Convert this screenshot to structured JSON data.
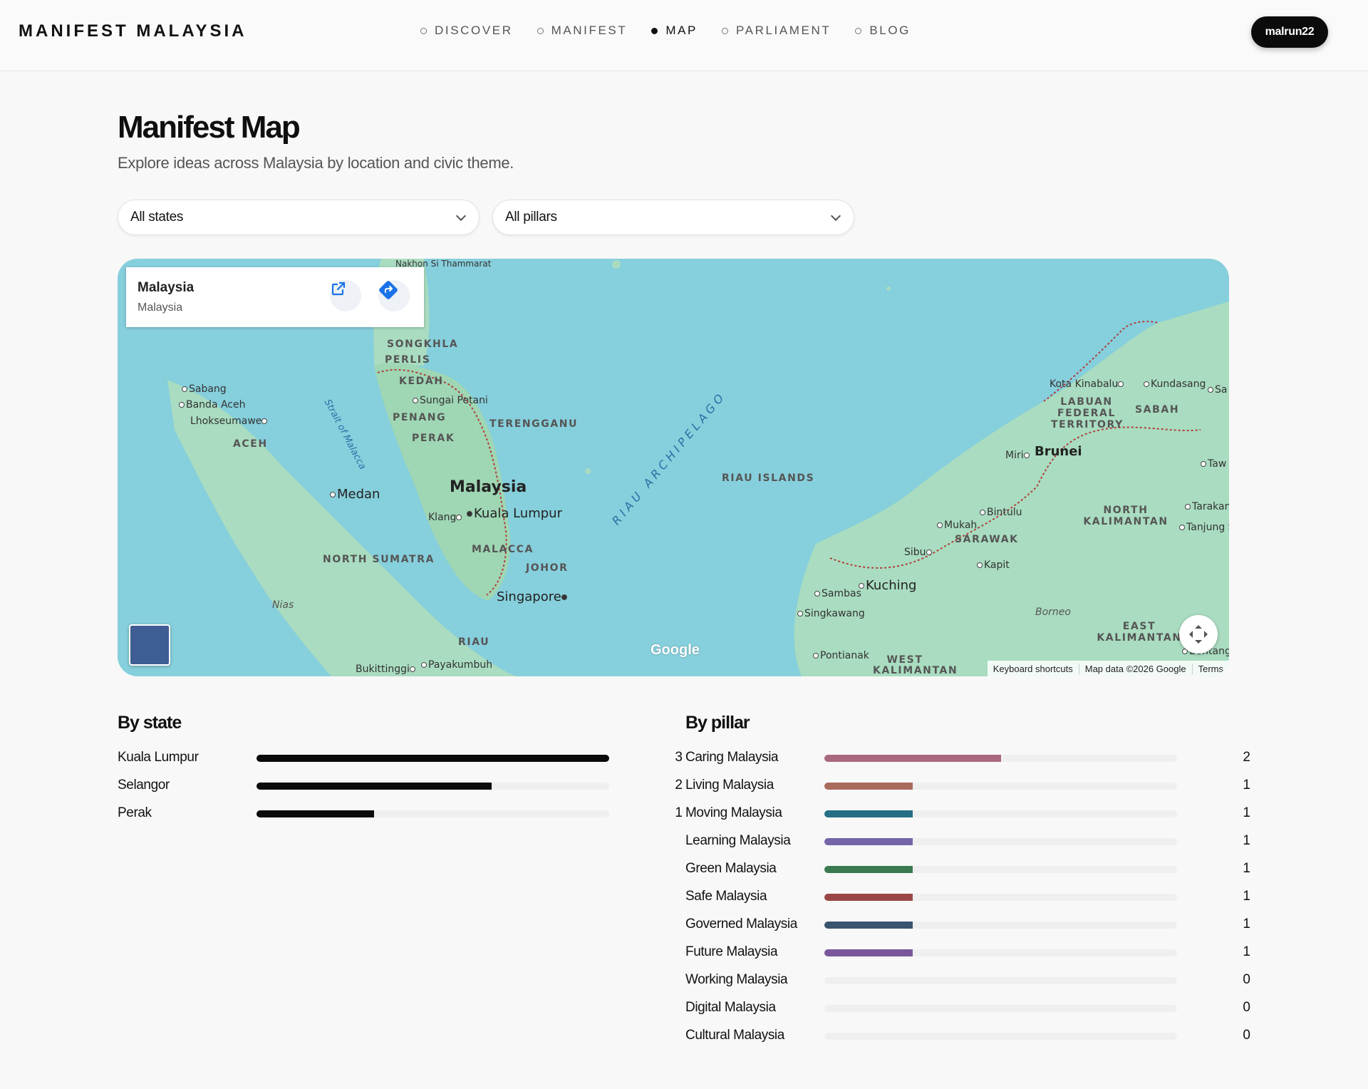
{
  "brand": "MANIFEST MALAYSIA",
  "nav": [
    {
      "label": "DISCOVER",
      "active": false
    },
    {
      "label": "MANIFEST",
      "active": false
    },
    {
      "label": "MAP",
      "active": true
    },
    {
      "label": "PARLIAMENT",
      "active": false
    },
    {
      "label": "BLOG",
      "active": false
    }
  ],
  "user": {
    "label": "malrun22"
  },
  "page": {
    "title": "Manifest Map",
    "subtitle": "Explore ideas across Malaysia by location and civic theme."
  },
  "filters": {
    "state": {
      "value": "All states"
    },
    "pillar": {
      "value": "All pillars"
    }
  },
  "map": {
    "info_card": {
      "title": "Malaysia",
      "subtitle": "Malaysia"
    },
    "labels": {
      "songkhla": "SONGKHLA",
      "perlis": "PERLIS",
      "kedah": "KEDAH",
      "sungai_petani": "Sungai Petani",
      "penang": "PENANG",
      "perak": "PERAK",
      "terengganu": "TERENGGANU",
      "malaysia": "Malaysia",
      "kuala_lumpur": "Kuala Lumpur",
      "klang": "Klang",
      "malacca": "MALACCA",
      "johor": "JOHOR",
      "singapore": "Singapore",
      "riau_islands": "RIAU ISLANDS",
      "riau_archipelago": "RIAU ARCHIPELAGO",
      "riau": "RIAU",
      "sabang": "Sabang",
      "banda_aceh": "Banda Aceh",
      "lhokseumawe": "Lhokseumawe",
      "aceh": "ACEH",
      "medan": "Medan",
      "north_sumatra": "NORTH SUMATRA",
      "nias": "Nias",
      "bukittinggi": "Bukittinggi",
      "payakumbuh": "Payakumbuh",
      "strait": "Strait of Malacca",
      "kota_kinabalu": "Kota Kinabalu",
      "kundasang": "Kundasang",
      "labuan": "LABUAN FEDERAL TERRITORY",
      "sabah": "SABAH",
      "miri": "Miri",
      "brunei": "Brunei",
      "bintulu": "Bintulu",
      "mukah": "Mukah",
      "sarawak": "SARAWAK",
      "sibu": "Sibu",
      "kapit": "Kapit",
      "kuching": "Kuching",
      "sambas": "Sambas",
      "singkawang": "Singkawang",
      "pontianak": "Pontianak",
      "west_kalimantan": "WEST KALIMANTAN",
      "north_kalimantan": "NORTH KALIMANTAN",
      "east_kalimantan": "EAST KALIMANTAN",
      "borneo": "Borneo",
      "tarakan": "Tarakan",
      "tanjung": "Tanjung S",
      "tawau": "Taw",
      "sa": "Sa",
      "bontang": "Bontang",
      "thai_top": "Nakhon Si Thammarat"
    },
    "google": "Google",
    "attribution": [
      "Keyboard shortcuts",
      "Map data ©2026 Google",
      "Terms"
    ],
    "colors": {
      "water": "#86cfdc",
      "land": "#a9dcc0",
      "border": "#b0413e"
    }
  },
  "by_state": {
    "heading": "By state",
    "max": 3,
    "bar_color": "#0b0b0b",
    "rows": [
      {
        "label": "Kuala Lumpur",
        "value": 3
      },
      {
        "label": "Selangor",
        "value": 2
      },
      {
        "label": "Perak",
        "value": 1
      }
    ]
  },
  "by_pillar": {
    "heading": "By pillar",
    "max": 4,
    "rows": [
      {
        "label": "Caring Malaysia",
        "value": 2,
        "color": "#a8687f"
      },
      {
        "label": "Living Malaysia",
        "value": 1,
        "color": "#a96b5c"
      },
      {
        "label": "Moving Malaysia",
        "value": 1,
        "color": "#246e86"
      },
      {
        "label": "Learning Malaysia",
        "value": 1,
        "color": "#7465a8"
      },
      {
        "label": "Green Malaysia",
        "value": 1,
        "color": "#3b7a50"
      },
      {
        "label": "Safe Malaysia",
        "value": 1,
        "color": "#9b4646"
      },
      {
        "label": "Governed Malaysia",
        "value": 1,
        "color": "#3b546f"
      },
      {
        "label": "Future Malaysia",
        "value": 1,
        "color": "#7a579a"
      },
      {
        "label": "Working Malaysia",
        "value": 0,
        "color": "#888888"
      },
      {
        "label": "Digital Malaysia",
        "value": 0,
        "color": "#888888"
      },
      {
        "label": "Cultural Malaysia",
        "value": 0,
        "color": "#888888"
      }
    ]
  }
}
